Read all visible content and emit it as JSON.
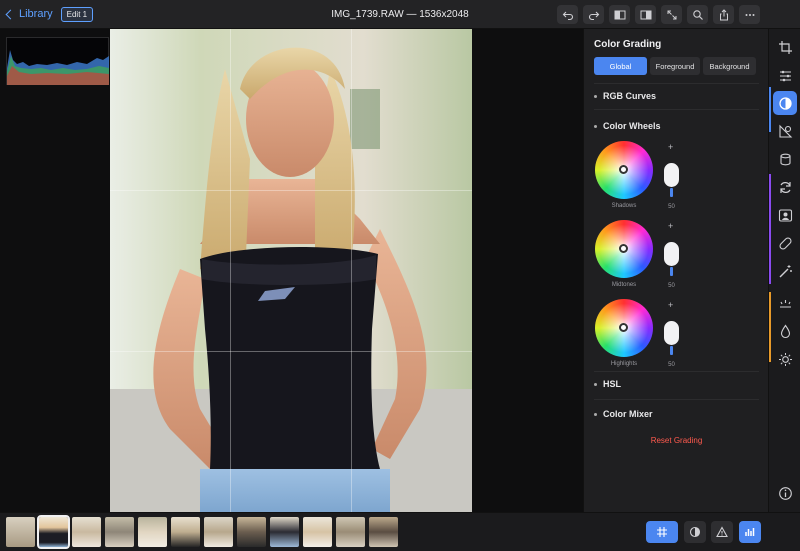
{
  "header": {
    "back_label": "Library",
    "edit_badge": "Edit 1",
    "title": "IMG_1739.RAW — 1536x2048",
    "tools": [
      "undo-icon",
      "redo-icon",
      "compare-before-icon",
      "compare-split-icon",
      "fullscreen-icon",
      "zoom-icon",
      "share-icon",
      "more-icon"
    ]
  },
  "panel": {
    "title": "Color Grading",
    "segments": [
      "Global",
      "Foreground",
      "Background"
    ],
    "active_segment": "Global",
    "sections": {
      "rgb_curves": "RGB Curves",
      "color_wheels": "Color Wheels",
      "hsl": "HSL",
      "color_mixer": "Color Mixer"
    },
    "wheels": [
      {
        "label": "Shadows",
        "value": "50",
        "plus": "+"
      },
      {
        "label": "Midtones",
        "value": "50",
        "plus": "+"
      },
      {
        "label": "Highlights",
        "value": "50",
        "plus": "+"
      }
    ],
    "reset_label": "Reset Grading",
    "accent_color": "#4b86f0",
    "reset_color": "#ff5a4e"
  },
  "rail_icons": [
    "crop-icon",
    "sliders-icon",
    "color-grading-icon",
    "selective-color-icon",
    "layers-icon",
    "rotate-icon",
    "portrait-icon",
    "healing-icon",
    "magic-wand-icon",
    "vignette-icon",
    "drop-icon",
    "sun-icon",
    "info-icon"
  ],
  "filmstrip": {
    "count": 12,
    "selected_index": 1
  },
  "bottom_buttons": [
    "grid-overlay-icon",
    "contrast-icon",
    "warning-icon",
    "histogram-icon"
  ]
}
